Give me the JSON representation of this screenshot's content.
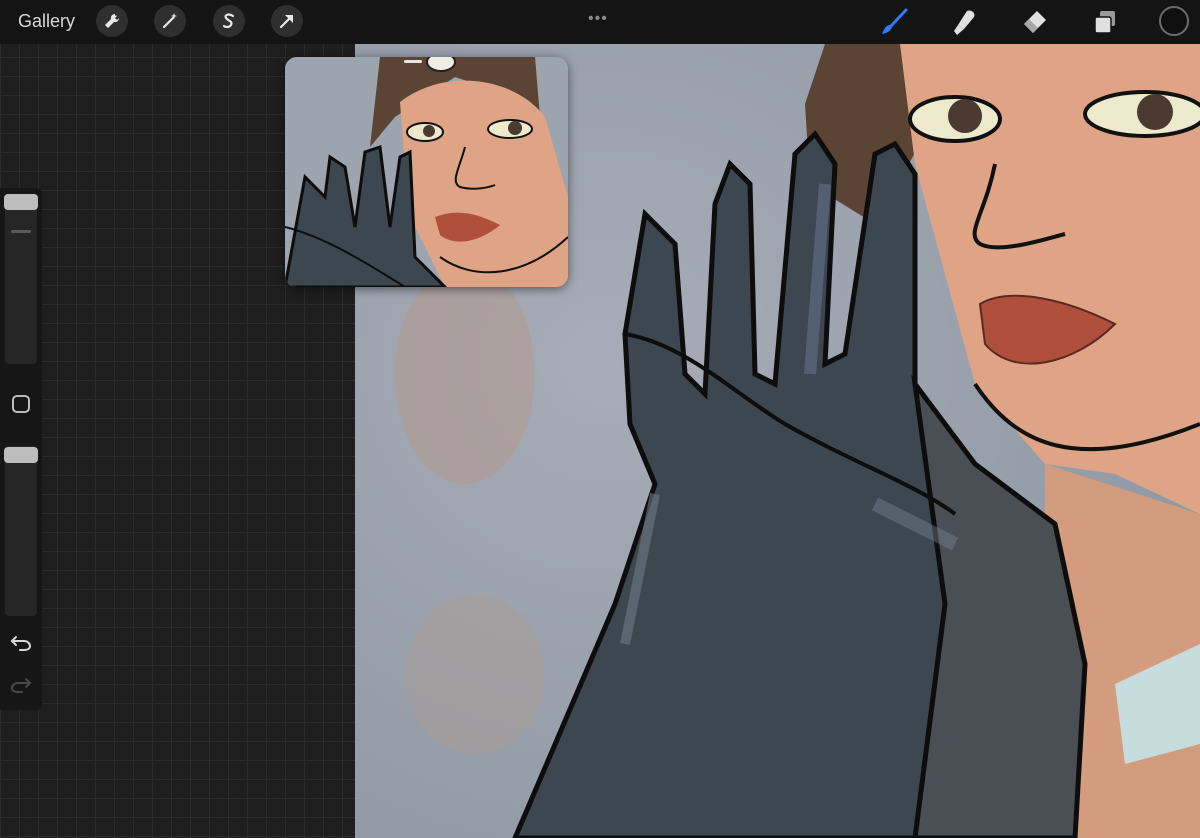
{
  "topbar": {
    "gallery_label": "Gallery",
    "left_tools": [
      "wrench-icon",
      "magic-wand-icon",
      "selection-s-icon",
      "transform-arrow-icon"
    ],
    "more_label": "•••",
    "right_tools": [
      "brush-icon",
      "smudge-icon",
      "eraser-icon",
      "layers-icon"
    ],
    "active_tool": "brush-icon",
    "active_color": "#2f7bf6",
    "current_color": "#0f0f0f"
  },
  "sidebar": {
    "brush_size": 0.95,
    "brush_opacity": 0.95,
    "tools": [
      "modify-square-icon",
      "undo-icon",
      "redo-icon"
    ]
  }
}
